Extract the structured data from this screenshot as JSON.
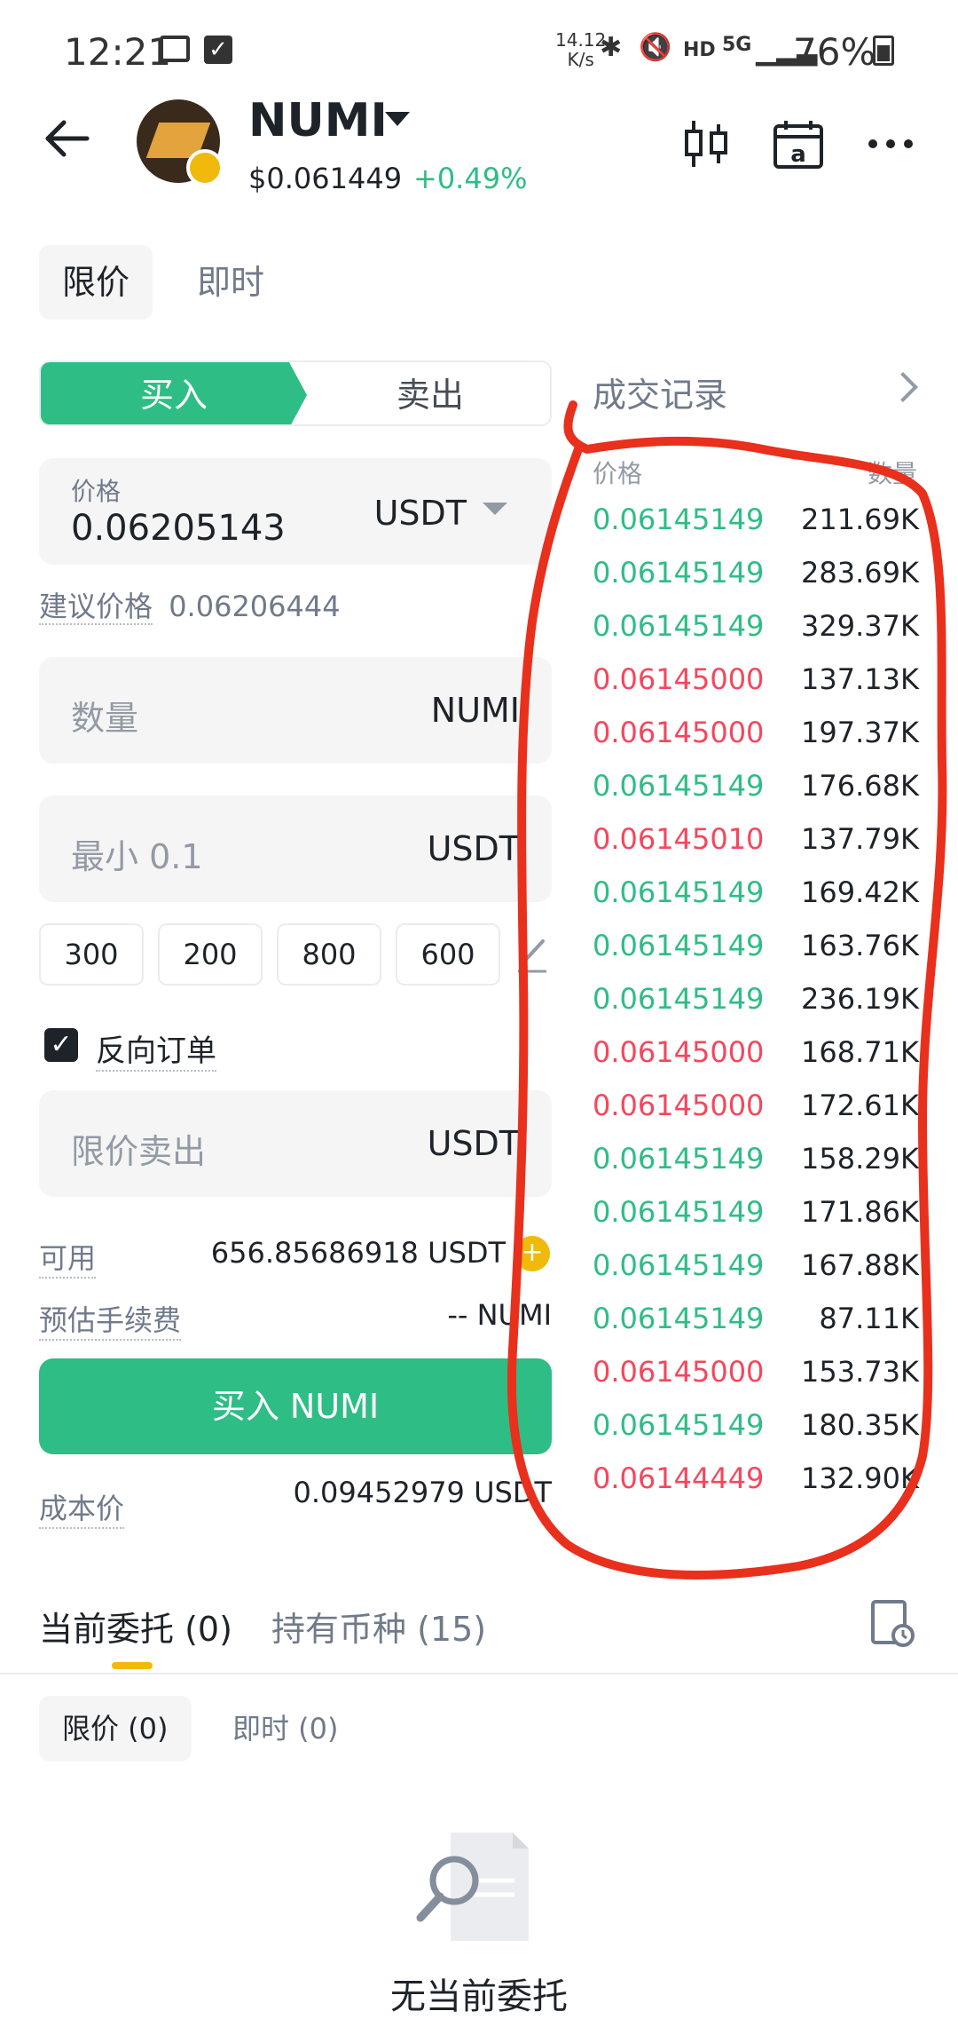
{
  "status_bar": {
    "time": "12:21",
    "net_speed_value": "14.12",
    "net_speed_unit": "K/s",
    "hd": "HD",
    "network": "5G",
    "battery": "76%"
  },
  "header": {
    "pair": "NUMI",
    "price": "$0.061449",
    "change": "+0.49%",
    "change_color": "#2ebd85",
    "icons": [
      "candlestick-chart-icon",
      "calendar-icon",
      "more-icon"
    ]
  },
  "order_types": [
    {
      "label": "限价",
      "active": true
    },
    {
      "label": "即时",
      "active": false
    }
  ],
  "side_toggle": {
    "buy": "买入",
    "sell": "卖出",
    "buy_color": "#2ebd85"
  },
  "price_field": {
    "label": "价格",
    "value": "0.06205143",
    "unit": "USDT"
  },
  "suggested_price": {
    "label": "建议价格",
    "value": "0.06206444"
  },
  "quantity_field": {
    "placeholder": "数量",
    "unit": "NUMI"
  },
  "total_field": {
    "placeholder": "最小 0.1",
    "unit": "USDT"
  },
  "presets": [
    "300",
    "200",
    "800",
    "600"
  ],
  "reverse_order": {
    "label": "反向订单",
    "checked": true
  },
  "limit_sell_field": {
    "placeholder": "限价卖出",
    "unit": "USDT"
  },
  "available": {
    "label": "可用",
    "value": "656.85686918 USDT"
  },
  "fee": {
    "label": "预估手续费",
    "value": "-- NUMI"
  },
  "buy_button": "买入 NUMI",
  "cost_price": {
    "label": "成本价",
    "value": "0.09452979 USDT"
  },
  "trades": {
    "title": "成交记录",
    "col_price": "价格",
    "col_qty": "数量",
    "rows": [
      {
        "price": "0.06145149",
        "qty": "211.69K",
        "side": "buy"
      },
      {
        "price": "0.06145149",
        "qty": "283.69K",
        "side": "buy"
      },
      {
        "price": "0.06145149",
        "qty": "329.37K",
        "side": "buy"
      },
      {
        "price": "0.06145000",
        "qty": "137.13K",
        "side": "sell"
      },
      {
        "price": "0.06145000",
        "qty": "197.37K",
        "side": "sell"
      },
      {
        "price": "0.06145149",
        "qty": "176.68K",
        "side": "buy"
      },
      {
        "price": "0.06145010",
        "qty": "137.79K",
        "side": "sell"
      },
      {
        "price": "0.06145149",
        "qty": "169.42K",
        "side": "buy"
      },
      {
        "price": "0.06145149",
        "qty": "163.76K",
        "side": "buy"
      },
      {
        "price": "0.06145149",
        "qty": "236.19K",
        "side": "buy"
      },
      {
        "price": "0.06145000",
        "qty": "168.71K",
        "side": "sell"
      },
      {
        "price": "0.06145000",
        "qty": "172.61K",
        "side": "sell"
      },
      {
        "price": "0.06145149",
        "qty": "158.29K",
        "side": "buy"
      },
      {
        "price": "0.06145149",
        "qty": "171.86K",
        "side": "buy"
      },
      {
        "price": "0.06145149",
        "qty": "167.88K",
        "side": "buy"
      },
      {
        "price": "0.06145149",
        "qty": "87.11K",
        "side": "buy"
      },
      {
        "price": "0.06145000",
        "qty": "153.73K",
        "side": "sell"
      },
      {
        "price": "0.06145149",
        "qty": "180.35K",
        "side": "buy"
      },
      {
        "price": "0.06144449",
        "qty": "132.90K",
        "side": "sell"
      }
    ]
  },
  "bottom_tabs": [
    {
      "label": "当前委托 (0)",
      "active": true
    },
    {
      "label": "持有币种 (15)",
      "active": false
    }
  ],
  "sub_tabs": [
    {
      "label": "限价 (0)",
      "active": true
    },
    {
      "label": "即时 (0)",
      "active": false
    }
  ],
  "empty_state": "无当前委托",
  "colors": {
    "green": "#2ebd85",
    "red": "#f6465d",
    "annotation": "#e8301c"
  }
}
